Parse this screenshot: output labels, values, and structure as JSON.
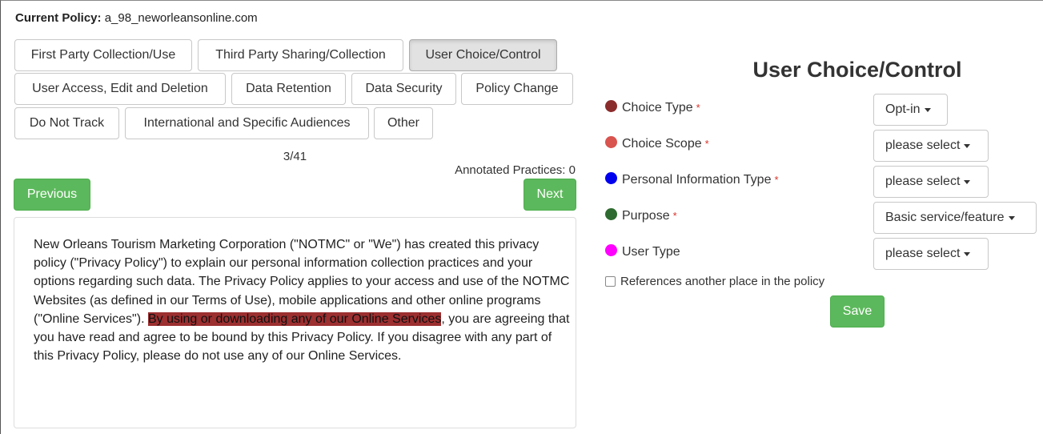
{
  "header": {
    "label": "Current Policy:",
    "policy_name": "a_98_neworleansonline.com"
  },
  "categories": [
    {
      "label": "First Party Collection/Use",
      "active": false
    },
    {
      "label": "Third Party Sharing/Collection",
      "active": false
    },
    {
      "label": "User Choice/Control",
      "active": true
    },
    {
      "label": "User Access, Edit and Deletion",
      "active": false
    },
    {
      "label": "Data Retention",
      "active": false
    },
    {
      "label": "Data Security",
      "active": false
    },
    {
      "label": "Policy Change",
      "active": false
    },
    {
      "label": "Do Not Track",
      "active": false
    },
    {
      "label": "International and Specific Audiences",
      "active": false
    },
    {
      "label": "Other",
      "active": false
    }
  ],
  "nav": {
    "counter": "3/41",
    "annotated_practices": "Annotated Practices: 0",
    "previous_label": "Previous",
    "next_label": "Next"
  },
  "policy_text": {
    "before": "New Orleans Tourism Marketing Corporation (\"NOTMC\" or \"We\") has created this privacy policy (\"Privacy Policy\") to explain our personal information collection practices and your options regarding such data. The Privacy Policy applies to your access and use of the NOTMC Websites (as defined in our Terms of Use), mobile applications and other online programs (\"Online Services\"). ",
    "highlight": "By using or downloading any of our Online Services",
    "after": ", you are agreeing that you have read and agree to be bound by this Privacy Policy. If you disagree with any part of this Privacy Policy, please do not use any of our Online Services.",
    "highlight_color": "#9c2f30"
  },
  "panel": {
    "title": "User Choice/Control",
    "fields": [
      {
        "label": "Choice Type",
        "required": true,
        "color": "#8b2c2c",
        "value": "Opt-in"
      },
      {
        "label": "Choice Scope",
        "required": true,
        "color": "#d9534f",
        "value": "please select"
      },
      {
        "label": "Personal Information Type",
        "required": true,
        "color": "#0000ee",
        "value": "please select"
      },
      {
        "label": "Purpose",
        "required": true,
        "color": "#2e6b30",
        "value": "Basic service/feature"
      },
      {
        "label": "User Type",
        "required": false,
        "color": "#ff00ff",
        "value": "please select"
      }
    ],
    "references_label": "References another place in the policy",
    "save_label": "Save"
  },
  "colors": {
    "accent_green": "#5cb85c"
  }
}
